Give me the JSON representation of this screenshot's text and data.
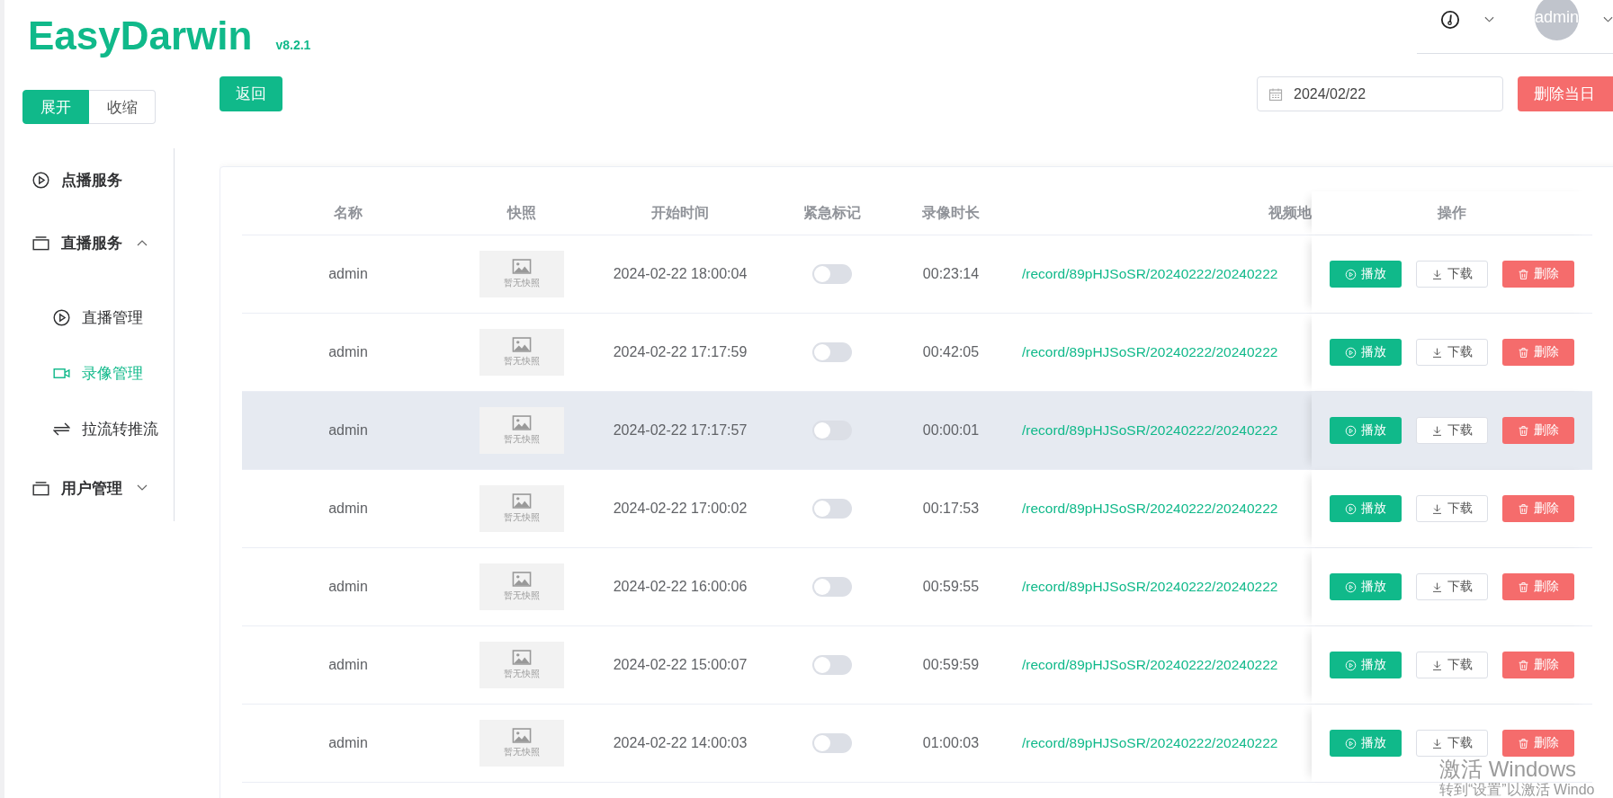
{
  "app": {
    "logo": "EasyDarwin",
    "version": "v8.2.1"
  },
  "user": {
    "avatar": "admin"
  },
  "sidebar_toggle": [
    {
      "label": "展开",
      "selected": true
    },
    {
      "label": "收缩",
      "selected": false
    }
  ],
  "menu": [
    {
      "label": "点播服务",
      "kind": "link",
      "selected": false
    },
    {
      "label": "直播服务",
      "kind": "group",
      "expanded": true,
      "children": [
        {
          "label": "直播管理",
          "selected": false
        },
        {
          "label": "录像管理",
          "selected": true
        },
        {
          "label": "拉流转推流",
          "selected": false
        }
      ]
    },
    {
      "label": "用户管理",
      "kind": "group",
      "expanded": false
    }
  ],
  "toolbar": {
    "back": "返回",
    "date": "2024/02/22",
    "delete_day": "删除当日"
  },
  "table": {
    "columns": [
      "名称",
      "快照",
      "开始时间",
      "紧急标记",
      "录像时长",
      "视频地",
      "操作"
    ],
    "rows": [
      {
        "name": "admin",
        "snapshot": "暂无快照",
        "start": "2024-02-22 18:00:04",
        "urgent": false,
        "duration": "00:23:14",
        "address": "/record/89pHJSoSR/20240222/20240222",
        "hovered": false,
        "actions": [
          {
            "label": "播放",
            "kind": "play"
          },
          {
            "label": "下载",
            "kind": "download"
          },
          {
            "label": "删除",
            "kind": "delete"
          }
        ]
      },
      {
        "name": "admin",
        "snapshot": "暂无快照",
        "start": "2024-02-22 17:17:59",
        "urgent": false,
        "duration": "00:42:05",
        "address": "/record/89pHJSoSR/20240222/20240222",
        "hovered": false,
        "actions": [
          {
            "label": "播放",
            "kind": "play"
          },
          {
            "label": "下载",
            "kind": "download"
          },
          {
            "label": "删除",
            "kind": "delete"
          }
        ]
      },
      {
        "name": "admin",
        "snapshot": "暂无快照",
        "start": "2024-02-22 17:17:57",
        "urgent": false,
        "duration": "00:00:01",
        "address": "/record/89pHJSoSR/20240222/20240222",
        "hovered": true,
        "actions": [
          {
            "label": "播放",
            "kind": "play"
          },
          {
            "label": "下载",
            "kind": "download"
          },
          {
            "label": "删除",
            "kind": "delete"
          }
        ]
      },
      {
        "name": "admin",
        "snapshot": "暂无快照",
        "start": "2024-02-22 17:00:02",
        "urgent": false,
        "duration": "00:17:53",
        "address": "/record/89pHJSoSR/20240222/20240222",
        "hovered": false,
        "actions": [
          {
            "label": "播放",
            "kind": "play"
          },
          {
            "label": "下载",
            "kind": "download"
          },
          {
            "label": "删除",
            "kind": "delete"
          }
        ]
      },
      {
        "name": "admin",
        "snapshot": "暂无快照",
        "start": "2024-02-22 16:00:06",
        "urgent": false,
        "duration": "00:59:55",
        "address": "/record/89pHJSoSR/20240222/20240222",
        "hovered": false,
        "actions": [
          {
            "label": "播放",
            "kind": "play"
          },
          {
            "label": "下载",
            "kind": "download"
          },
          {
            "label": "删除",
            "kind": "delete"
          }
        ]
      },
      {
        "name": "admin",
        "snapshot": "暂无快照",
        "start": "2024-02-22 15:00:07",
        "urgent": false,
        "duration": "00:59:59",
        "address": "/record/89pHJSoSR/20240222/20240222",
        "hovered": false,
        "actions": [
          {
            "label": "播放",
            "kind": "play"
          },
          {
            "label": "下载",
            "kind": "download"
          },
          {
            "label": "删除",
            "kind": "delete"
          }
        ]
      },
      {
        "name": "admin",
        "snapshot": "暂无快照",
        "start": "2024-02-22 14:00:03",
        "urgent": false,
        "duration": "01:00:03",
        "address": "/record/89pHJSoSR/20240222/20240222",
        "hovered": false,
        "actions": [
          {
            "label": "播放",
            "kind": "play"
          },
          {
            "label": "下载",
            "kind": "download"
          },
          {
            "label": "删除",
            "kind": "delete"
          }
        ]
      }
    ]
  },
  "os_notice": {
    "title": "激活 Windows",
    "text": "转到“设置”以激活 Windo"
  }
}
